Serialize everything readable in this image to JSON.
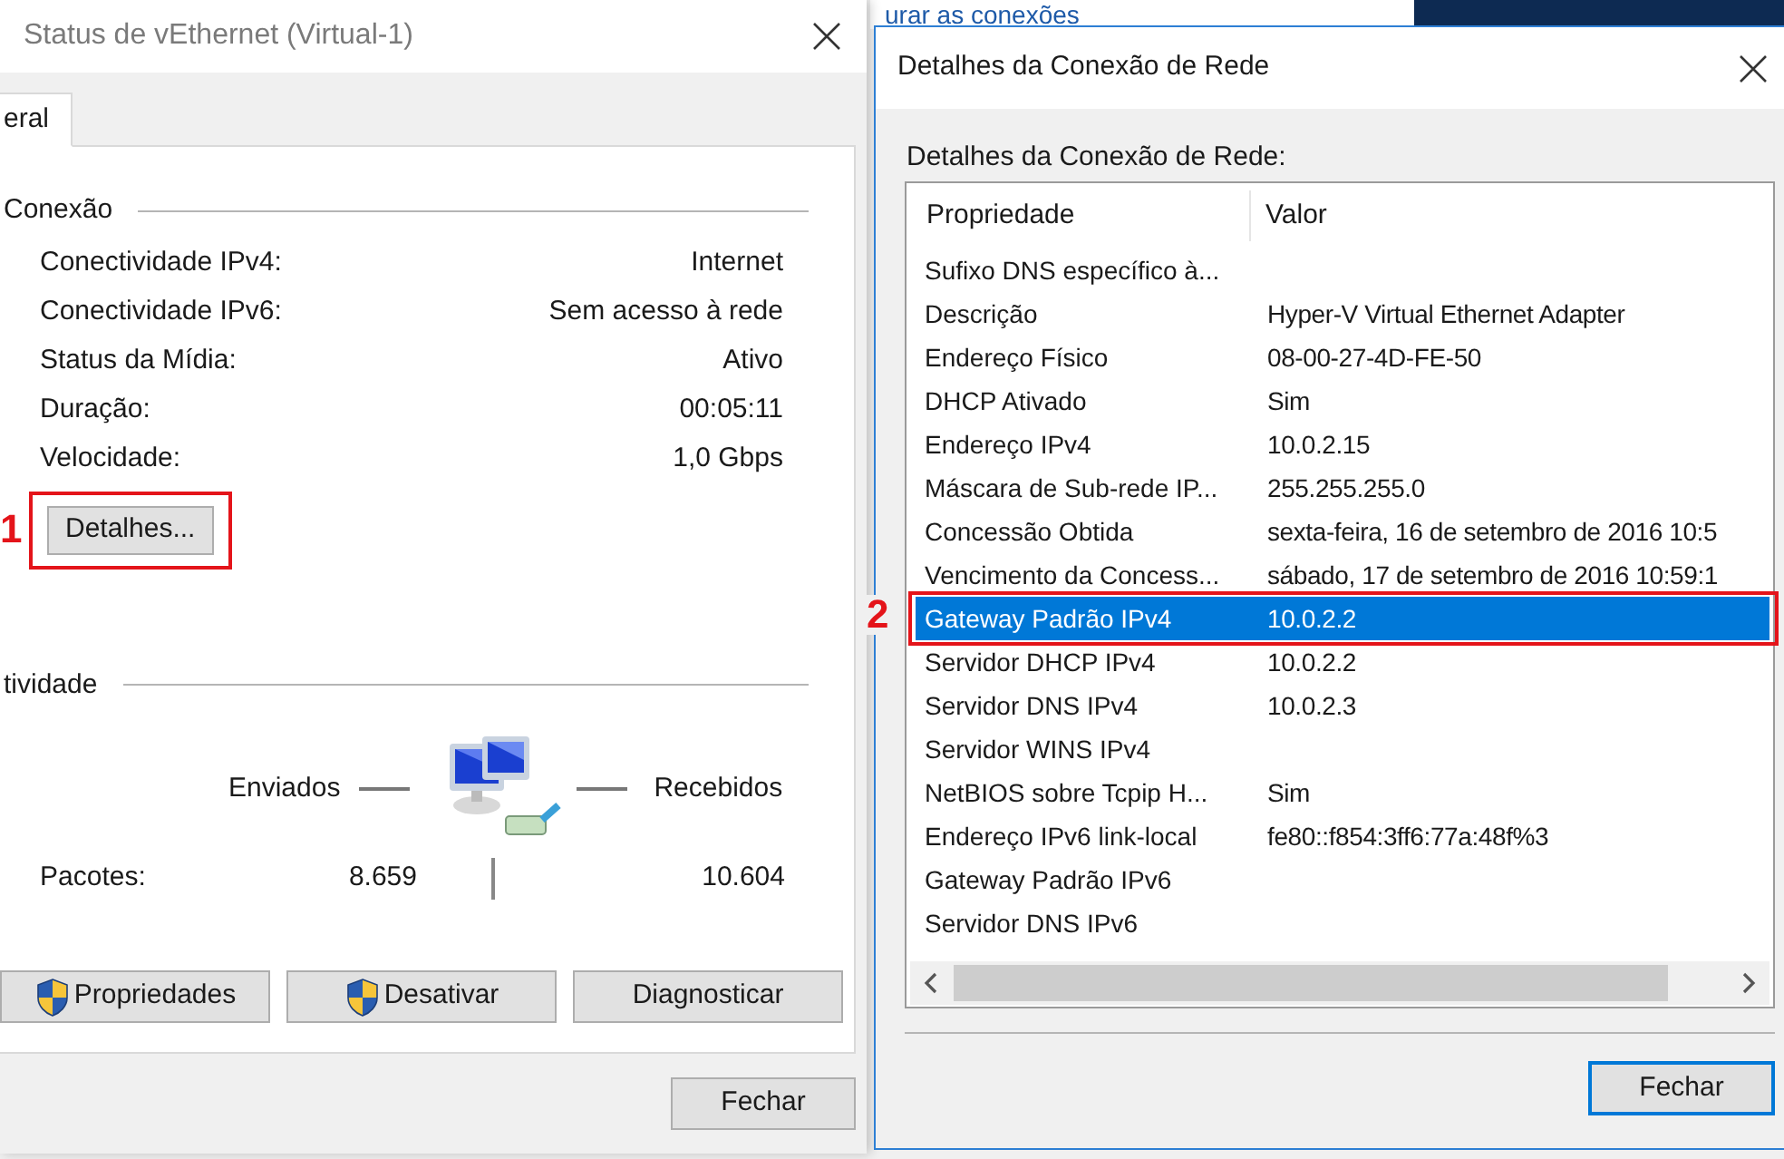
{
  "background_window": {
    "title_fragment": "urar as conexões"
  },
  "status_dialog": {
    "title": "Status de vEthernet (Virtual-1)",
    "tabs": [
      {
        "label": "eral",
        "selected": true
      }
    ],
    "connection": {
      "heading": "Conexão",
      "fields": [
        {
          "label": "Conectividade IPv4:",
          "value": "Internet"
        },
        {
          "label": "Conectividade IPv6:",
          "value": "Sem acesso à rede"
        },
        {
          "label": "Status da Mídia:",
          "value": "Ativo"
        },
        {
          "label": "Duração:",
          "value": "00:05:11"
        },
        {
          "label": "Velocidade:",
          "value": "1,0 Gbps"
        }
      ],
      "details_button": "Detalhes...",
      "details_annotation": "1"
    },
    "activity": {
      "heading": "tividade",
      "sent_label": "Enviados",
      "received_label": "Recebidos",
      "packets_label": "Pacotes:",
      "packets_sent": "8.659",
      "packets_received": "10.604"
    },
    "buttons": [
      {
        "label": "Propriedades",
        "shield": true
      },
      {
        "label": "Desativar",
        "shield": true
      },
      {
        "label": "Diagnosticar",
        "shield": false
      }
    ],
    "close_button": "Fechar"
  },
  "details_dialog": {
    "title": "Detalhes da Conexão de Rede",
    "label": "Detalhes da Conexão de Rede:",
    "table": {
      "columns": [
        "Propriedade",
        "Valor"
      ],
      "selected_annotation": "2",
      "rows": [
        {
          "property": "Sufixo DNS específico à...",
          "selected": false
        },
        {
          "property": "Descrição",
          "value": "Hyper-V Virtual Ethernet Adapter",
          "selected": false
        },
        {
          "property": "Endereço Físico",
          "value": "08-00-27-4D-FE-50",
          "selected": false
        },
        {
          "property": "DHCP Ativado",
          "value": "Sim",
          "selected": false
        },
        {
          "property": "Endereço IPv4",
          "value": "10.0.2.15",
          "selected": false
        },
        {
          "property": "Máscara de Sub-rede IP...",
          "value": "255.255.255.0",
          "selected": false
        },
        {
          "property": "Concessão Obtida",
          "value": "sexta-feira, 16 de setembro de 2016 10:5",
          "selected": false
        },
        {
          "property": "Vencimento da Concess...",
          "value": "sábado, 17 de setembro de 2016 10:59:1",
          "selected": false
        },
        {
          "property": "Gateway Padrão IPv4",
          "value": "10.0.2.2",
          "selected": true
        },
        {
          "property": "Servidor DHCP IPv4",
          "value": "10.0.2.2",
          "selected": false
        },
        {
          "property": "Servidor DNS IPv4",
          "value": "10.0.2.3",
          "selected": false
        },
        {
          "property": "Servidor WINS IPv4",
          "selected": false
        },
        {
          "property": "NetBIOS sobre Tcpip H...",
          "value": "Sim",
          "selected": false
        },
        {
          "property": "Endereço IPv6 link-local",
          "value": "fe80::f854:3ff6:77a:48f%3",
          "selected": false
        },
        {
          "property": "Gateway Padrão IPv6",
          "selected": false
        },
        {
          "property": "Servidor DNS IPv6",
          "selected": false
        }
      ]
    },
    "close_button": "Fechar"
  }
}
